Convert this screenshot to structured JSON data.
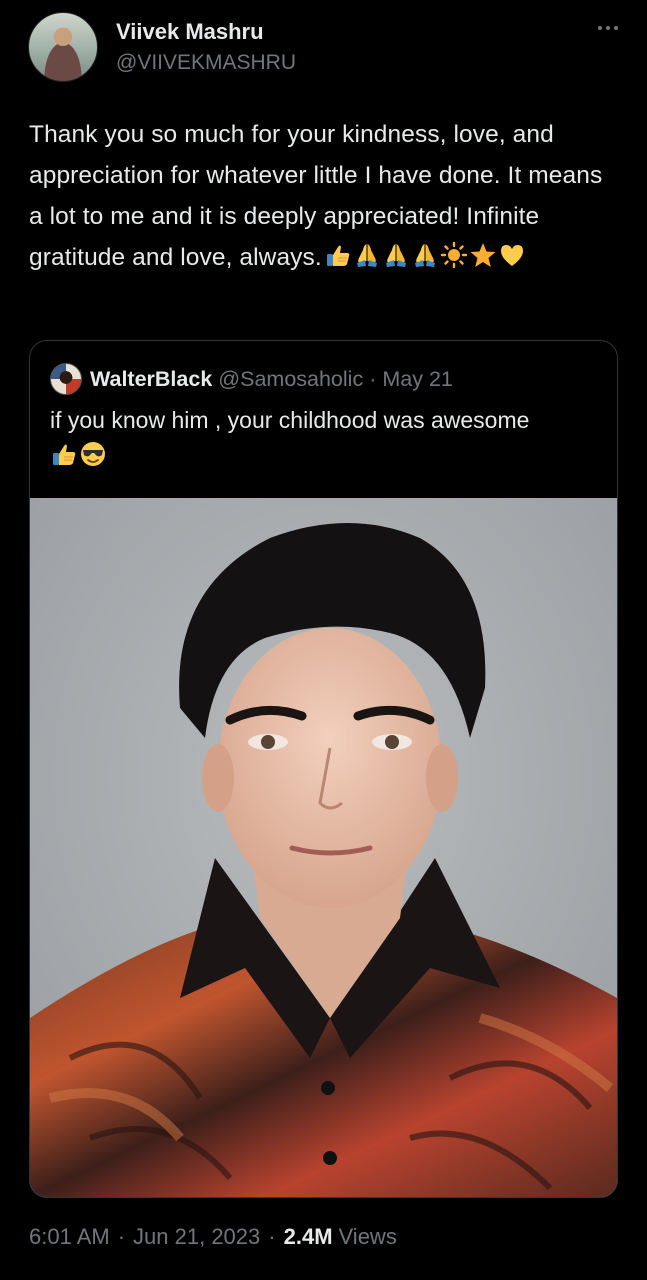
{
  "tweet": {
    "author": {
      "display_name": "Viivek Mashru",
      "handle": "@VIIVEKMASHRU"
    },
    "text": "Thank you so much for your kindness, love, and appreciation for whatever little I have done. It means a lot to me and it is deeply appreciated! Infinite gratitude and love, always.",
    "text_emojis": [
      "thumbs-up",
      "folded-hands",
      "folded-hands",
      "folded-hands",
      "sun",
      "star",
      "yellow-heart"
    ],
    "more_icon": "more-horizontal-icon"
  },
  "quote": {
    "author": {
      "display_name": "WalterBlack",
      "handle": "@Samosaholic"
    },
    "separator": "·",
    "date": "May 21",
    "text": "if you know him , your childhood was awesome",
    "text_emojis": [
      "thumbs-up",
      "smiling-face-with-sunglasses"
    ]
  },
  "meta": {
    "time": "6:01 AM",
    "separator": "·",
    "date": "Jun 21, 2023",
    "views_count": "2.4M",
    "views_label": "Views"
  },
  "colors": {
    "background": "#000000",
    "text_primary": "#e7e9ea",
    "text_secondary": "#71767b",
    "border": "#333639"
  }
}
